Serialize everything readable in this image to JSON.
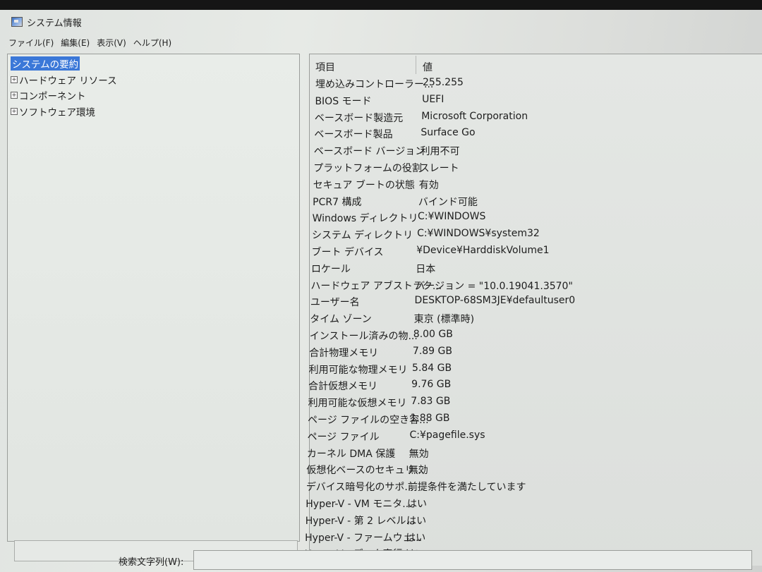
{
  "window": {
    "title": "システム情報"
  },
  "menu": [
    "ファイル(F)",
    "編集(E)",
    "表示(V)",
    "ヘルプ(H)"
  ],
  "tree": [
    {
      "label": "システムの要約",
      "selected": true,
      "expandable": false
    },
    {
      "label": "ハードウェア リソース",
      "selected": false,
      "expandable": true
    },
    {
      "label": "コンポーネント",
      "selected": false,
      "expandable": true
    },
    {
      "label": "ソフトウェア環境",
      "selected": false,
      "expandable": true
    }
  ],
  "table": {
    "headers": {
      "item": "項目",
      "value": "値"
    },
    "rows": [
      {
        "item": "埋め込みコントローラー...",
        "value": "255.255"
      },
      {
        "item": "BIOS モード",
        "value": "UEFI"
      },
      {
        "item": "ベースボード製造元",
        "value": "Microsoft Corporation"
      },
      {
        "item": "ベースボード製品",
        "value": "Surface Go"
      },
      {
        "item": "ベースボード バージョン",
        "value": "利用不可"
      },
      {
        "item": "プラットフォームの役割",
        "value": "スレート"
      },
      {
        "item": "セキュア ブートの状態",
        "value": "有効"
      },
      {
        "item": "PCR7 構成",
        "value": "バインド可能"
      },
      {
        "item": "Windows ディレクトリ",
        "value": "C:¥WINDOWS"
      },
      {
        "item": "システム ディレクトリ",
        "value": "C:¥WINDOWS¥system32"
      },
      {
        "item": "ブート デバイス",
        "value": "¥Device¥HarddiskVolume1"
      },
      {
        "item": "ロケール",
        "value": "日本"
      },
      {
        "item": "ハードウェア アブストラク...",
        "value": "バージョン = \"10.0.19041.3570\""
      },
      {
        "item": "ユーザー名",
        "value": "DESKTOP-68SM3JE¥defaultuser0"
      },
      {
        "item": "タイム ゾーン",
        "value": "東京 (標準時)"
      },
      {
        "item": "インストール済みの物...",
        "value": "8.00 GB"
      },
      {
        "item": "合計物理メモリ",
        "value": "7.89 GB"
      },
      {
        "item": "利用可能な物理メモリ",
        "value": "5.84 GB"
      },
      {
        "item": "合計仮想メモリ",
        "value": "9.76 GB"
      },
      {
        "item": "利用可能な仮想メモリ",
        "value": "7.83 GB"
      },
      {
        "item": "ページ ファイルの空き容...",
        "value": "1.88 GB"
      },
      {
        "item": "ページ ファイル",
        "value": "C:¥pagefile.sys"
      },
      {
        "item": "カーネル DMA 保護",
        "value": "無効"
      },
      {
        "item": "仮想化ベースのセキュリ...",
        "value": "無効"
      },
      {
        "item": "デバイス暗号化のサポ...",
        "value": "前提条件を満たしています"
      },
      {
        "item": "Hyper-V - VM モニタ...",
        "value": "はい"
      },
      {
        "item": "Hyper-V - 第 2 レベル...",
        "value": "はい"
      },
      {
        "item": "Hyper-V - ファームウェ...",
        "value": "はい"
      },
      {
        "item": "Hyper-V - データ実行...",
        "value": "はい"
      }
    ]
  },
  "search": {
    "label": "検索文字列(W):",
    "value": ""
  },
  "colors": {
    "selection": "#3b78d8",
    "border": "#9a9d9a"
  }
}
